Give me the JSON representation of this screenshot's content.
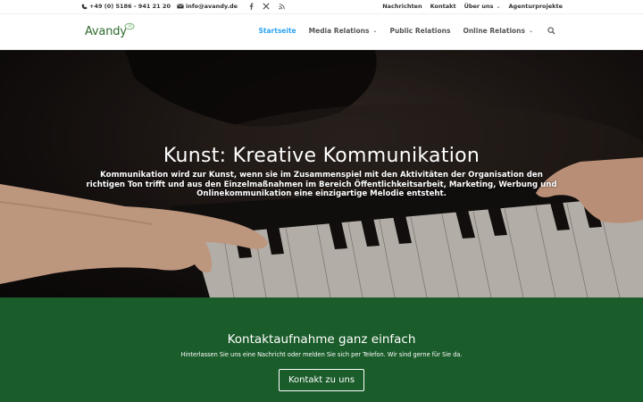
{
  "topbar": {
    "phone": "+49 (0) 5186 - 941 21 20",
    "email": "info@avandy.de",
    "social": [
      "facebook-icon",
      "x-twitter-icon",
      "rss-icon"
    ],
    "links": [
      {
        "label": "Nachrichten",
        "has_dropdown": false
      },
      {
        "label": "Kontakt",
        "has_dropdown": false
      },
      {
        "label": "Über uns",
        "has_dropdown": true
      },
      {
        "label": "Agenturprojekte",
        "has_dropdown": false
      }
    ]
  },
  "header": {
    "logo_text": "Avandy",
    "nav": [
      {
        "label": "Startseite",
        "active": true,
        "has_dropdown": false
      },
      {
        "label": "Media Relations",
        "active": false,
        "has_dropdown": true
      },
      {
        "label": "Public Relations",
        "active": false,
        "has_dropdown": false
      },
      {
        "label": "Online Relations",
        "active": false,
        "has_dropdown": true
      }
    ],
    "search_icon": "search-icon"
  },
  "hero": {
    "title": "Kunst: Kreative Kommunikation",
    "text": "Kommunikation wird zur Kunst, wenn sie im Zusammenspiel mit den Aktivitäten der Organisation den richtigen Ton trifft und aus den Einzelmaßnahmen im Bereich Öffentlichkeitsarbeit, Marketing, Werbung und Onlinekommunikation eine einzigartige Melodie entsteht."
  },
  "cta": {
    "title": "Kontaktaufnahme ganz einfach",
    "subtitle": "Hinterlassen Sie uns eine Nachricht oder melden Sie sich per Telefon. Wir sind gerne für Sie da.",
    "button_label": "Kontakt zu uns"
  },
  "colors": {
    "accent": "#2ea3f2",
    "cta_green": "#1b5c2b",
    "logo_green": "#2f6b2f"
  }
}
